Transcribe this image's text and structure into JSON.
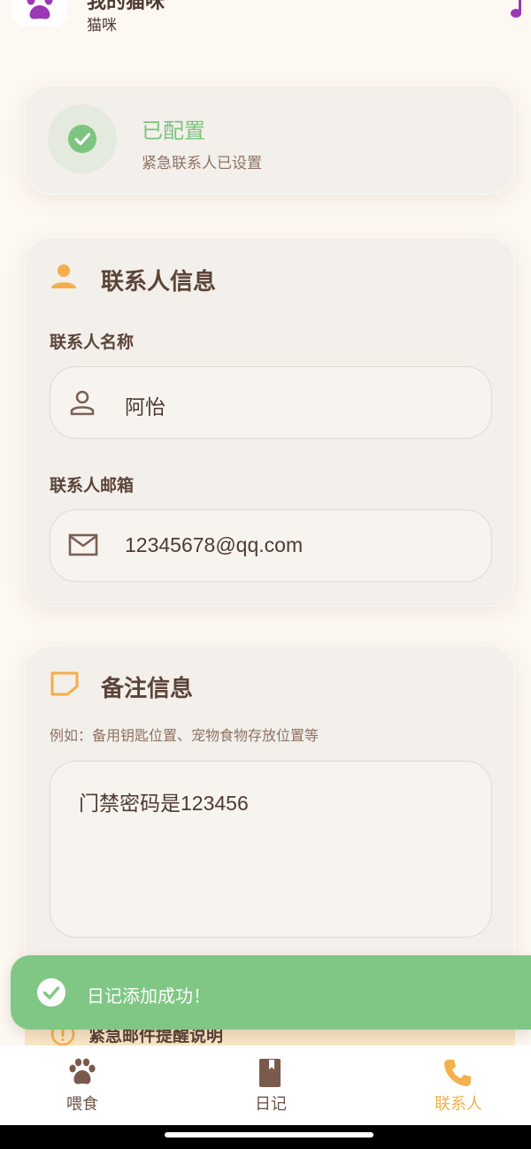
{
  "header": {
    "title": "我的猫咪",
    "subtitle": "猫咪",
    "logo_icon": "paw-icon",
    "right_icon": "music-note-icon"
  },
  "status": {
    "title": "已配置",
    "description": "紧急联系人已设置",
    "icon": "check-circle-icon",
    "color": "#7cc47f"
  },
  "contact": {
    "section_title": "联系人信息",
    "name_label": "联系人名称",
    "name_value": "阿怡",
    "email_label": "联系人邮箱",
    "email_value": "12345678@qq.com"
  },
  "note": {
    "section_title": "备注信息",
    "hint": "例如：备用钥匙位置、宠物食物存放位置等",
    "value": "门禁密码是123456"
  },
  "reminder": {
    "title": "紧急邮件提醒说明"
  },
  "toast": {
    "message": "日记添加成功！",
    "color": "#80c785"
  },
  "nav": {
    "items": [
      {
        "label": "喂食",
        "icon": "paw-icon"
      },
      {
        "label": "日记",
        "icon": "book-icon"
      },
      {
        "label": "联系人",
        "icon": "phone-icon"
      }
    ],
    "active_color": "#f4b04a"
  }
}
